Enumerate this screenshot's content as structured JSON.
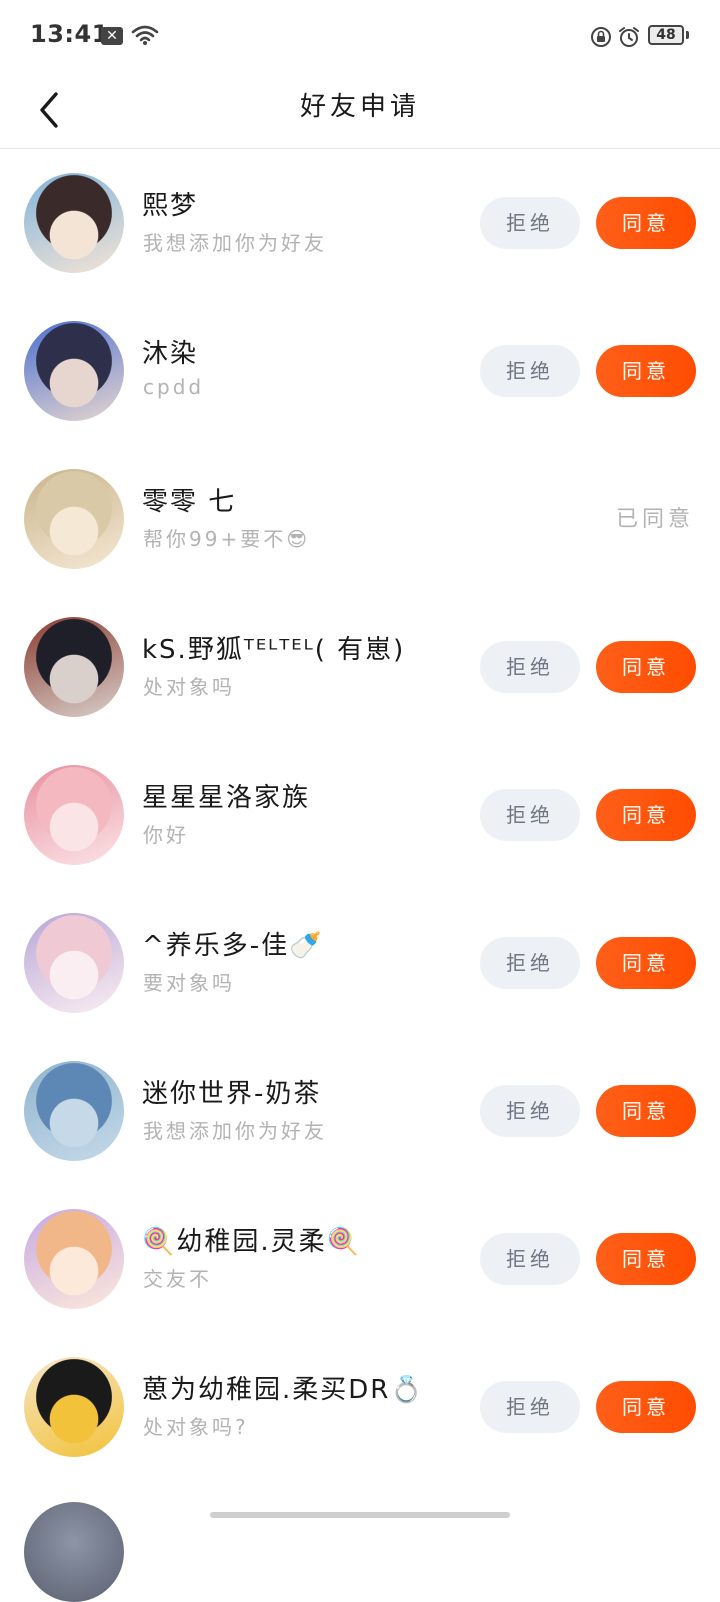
{
  "status_bar": {
    "time": "13:41",
    "notification": "✕",
    "battery": "48"
  },
  "header": {
    "title": "好友申请"
  },
  "buttons": {
    "reject": "拒绝",
    "accept": "同意"
  },
  "requests": [
    {
      "name": "熙梦",
      "message": "我想添加你为好友",
      "status": "pending",
      "avatar_colors": [
        "#3a2b2a",
        "#f4e4d6",
        "#7fb3d9"
      ]
    },
    {
      "name": "沐染",
      "message": "cpdd",
      "status": "pending",
      "avatar_colors": [
        "#2e2f4a",
        "#e7d6cf",
        "#4a6fd0"
      ]
    },
    {
      "name": "零零 七",
      "message": "帮你99+要不😎",
      "status": "accepted",
      "status_text": "已同意",
      "avatar_colors": [
        "#d9c9a6",
        "#f5e8d4",
        "#c9b48a"
      ]
    },
    {
      "name": "kS.野狐ᵀᴱᴸᵀᴱᴸ( 有崽)",
      "message": "处对象吗",
      "status": "pending",
      "avatar_colors": [
        "#1f1f2a",
        "#d9d0cc",
        "#8a3b2e"
      ]
    },
    {
      "name": "星星星洛家族",
      "message": "你好",
      "status": "pending",
      "avatar_colors": [
        "#f3b8c0",
        "#fbe4e6",
        "#e88fa0"
      ]
    },
    {
      "name": "^养乐多-佳🍼",
      "message": "要对象吗",
      "status": "pending",
      "avatar_colors": [
        "#efc9d3",
        "#fbeef2",
        "#b7a6d6"
      ]
    },
    {
      "name": "迷你世界-奶茶",
      "message": "我想添加你为好友",
      "status": "pending",
      "avatar_colors": [
        "#5d88b5",
        "#c5d9e8",
        "#8fb4cf"
      ]
    },
    {
      "name": "🍭幼稚园.灵柔🍭",
      "message": "交友不",
      "status": "pending",
      "avatar_colors": [
        "#f2b788",
        "#fde9da",
        "#c6a8e5"
      ]
    },
    {
      "name": "葸为幼稚园.柔买DR💍",
      "message": "处对象吗?",
      "status": "pending",
      "avatar_colors": [
        "#1a1a1a",
        "#f2c23a",
        "#f6e6c8"
      ]
    }
  ]
}
